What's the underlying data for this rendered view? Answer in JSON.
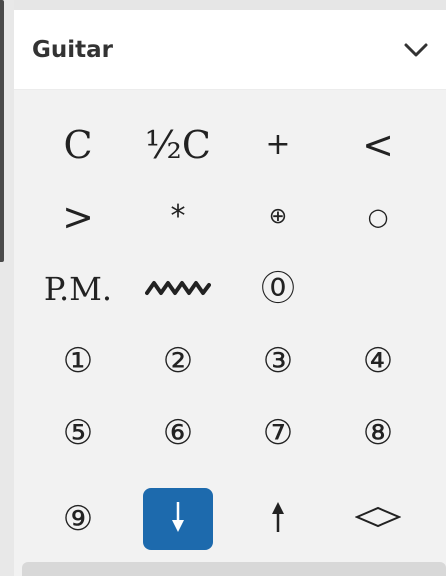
{
  "panel": {
    "title": "Guitar",
    "collapse_icon": "chevron-down-icon"
  },
  "symbols": [
    {
      "id": "capo",
      "label": "C"
    },
    {
      "id": "half-capo",
      "label": "½C"
    },
    {
      "id": "plus",
      "label": "+"
    },
    {
      "id": "crescendo",
      "label": "<"
    },
    {
      "id": "decrescendo",
      "label": ">"
    },
    {
      "id": "asterisk",
      "label": "*"
    },
    {
      "id": "circled-plus",
      "label": "⊕"
    },
    {
      "id": "open-circle",
      "label": "○"
    },
    {
      "id": "palm-mute",
      "label": "P.M."
    },
    {
      "id": "vibrato",
      "label": "vibrato-icon"
    },
    {
      "id": "string-0",
      "label": "⓪"
    },
    {
      "id": "string-1",
      "label": "①"
    },
    {
      "id": "string-2",
      "label": "②"
    },
    {
      "id": "string-3",
      "label": "③"
    },
    {
      "id": "string-4",
      "label": "④"
    },
    {
      "id": "string-5",
      "label": "⑤"
    },
    {
      "id": "string-6",
      "label": "⑥"
    },
    {
      "id": "string-7",
      "label": "⑦"
    },
    {
      "id": "string-8",
      "label": "⑧"
    },
    {
      "id": "string-9",
      "label": "⑨"
    },
    {
      "id": "strum-down",
      "label": "arrow-down-icon",
      "selected": true
    },
    {
      "id": "strum-up",
      "label": "arrow-up-icon"
    },
    {
      "id": "diamond",
      "label": "diamond-icon"
    }
  ],
  "colors": {
    "accent": "#1d6aad",
    "panel_bg": "#f2f2f2",
    "header_bg": "#ffffff"
  }
}
